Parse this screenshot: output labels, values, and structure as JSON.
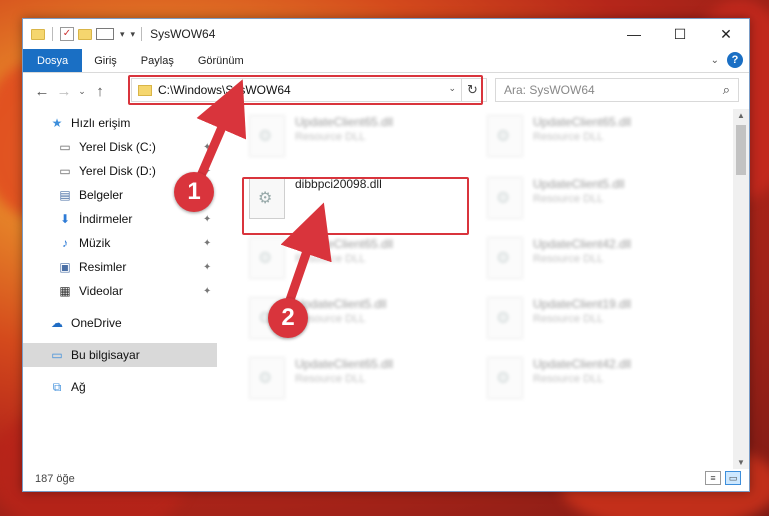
{
  "window": {
    "title": "SysWOW64",
    "controls": {
      "minimize": "—",
      "maximize": "☐",
      "close": "✕"
    }
  },
  "ribbon": {
    "tabs": [
      "Dosya",
      "Giriş",
      "Paylaş",
      "Görünüm"
    ],
    "expand": "⌄",
    "help": "?"
  },
  "nav": {
    "back": "←",
    "forward": "→",
    "recent": "⌄",
    "up": "↑",
    "address": "C:\\Windows\\SysWOW64",
    "address_dropdown": "⌄",
    "refresh": "↻",
    "search_placeholder": "Ara: SysWOW64"
  },
  "sidebar": {
    "items": [
      {
        "label": "Hızlı erişim",
        "icon": "star-icon",
        "glyph": "★",
        "color": "#3d8edb"
      },
      {
        "label": "Yerel Disk (C:)",
        "icon": "drive-icon",
        "glyph": "▭",
        "color": "#666",
        "pinned": true
      },
      {
        "label": "Yerel Disk (D:)",
        "icon": "drive-icon",
        "glyph": "▭",
        "color": "#666",
        "pinned": true
      },
      {
        "label": "Belgeler",
        "icon": "documents-icon",
        "glyph": "▤",
        "color": "#4a6fa5",
        "pinned": true
      },
      {
        "label": "İndirmeler",
        "icon": "downloads-icon",
        "glyph": "⬇",
        "color": "#2e7bd6",
        "pinned": true
      },
      {
        "label": "Müzik",
        "icon": "music-icon",
        "glyph": "♪",
        "color": "#2e7bd6",
        "pinned": true
      },
      {
        "label": "Resimler",
        "icon": "pictures-icon",
        "glyph": "▣",
        "color": "#4a6fa5",
        "pinned": true
      },
      {
        "label": "Videolar",
        "icon": "videos-icon",
        "glyph": "▦",
        "color": "#333",
        "pinned": true
      },
      {
        "label": "OneDrive",
        "icon": "cloud-icon",
        "glyph": "☁",
        "color": "#1f6cc4"
      },
      {
        "label": "Bu bilgisayar",
        "icon": "computer-icon",
        "glyph": "▭",
        "color": "#3d8edb"
      },
      {
        "label": "Ağ",
        "icon": "network-icon",
        "glyph": "⧉",
        "color": "#3d8edb"
      }
    ],
    "pin_glyph": "📌"
  },
  "files": {
    "highlighted": {
      "name": "dibbpci20098.dll"
    },
    "blurred": [
      {
        "name": "UpdateClient65.dll",
        "type": "Resource DLL"
      },
      {
        "name": "UpdateClient65.dll",
        "type": "Resource DLL"
      },
      {
        "name": "UpdateClient5.dll",
        "type": "Resource DLL"
      },
      {
        "name": "UpdateClient65.dll",
        "type": "Resource DLL"
      },
      {
        "name": "UpdateClient42.dll",
        "type": "Resource DLL"
      },
      {
        "name": "UpdateClient5.dll",
        "type": "Resource DLL"
      },
      {
        "name": "UpdateClient19.dll",
        "type": "Resource DLL"
      },
      {
        "name": "UpdateClient65.dll",
        "type": "Resource DLL"
      },
      {
        "name": "UpdateClient42.dll",
        "type": "Resource DLL"
      }
    ]
  },
  "status": {
    "count": "187 öğe"
  },
  "callouts": {
    "one": "1",
    "two": "2"
  },
  "colors": {
    "accent": "#1a6fc4",
    "highlight": "#d9343c"
  }
}
